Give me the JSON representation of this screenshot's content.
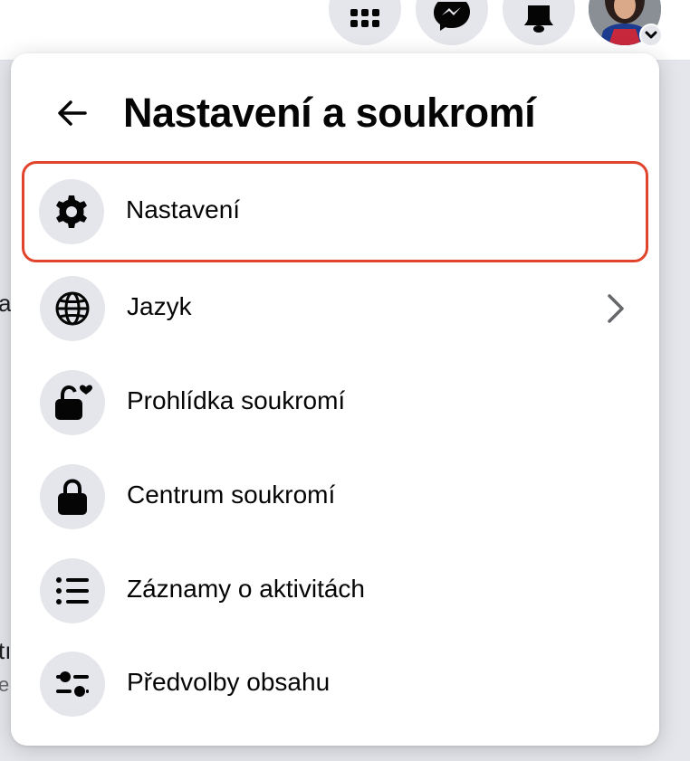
{
  "colors": {
    "page_bg": "#e4e6eb",
    "panel_bg": "#ffffff",
    "icon_bg": "#e4e6eb",
    "highlight_border": "#e0442c",
    "text": "#050505"
  },
  "topbar": {
    "icons": [
      "apps-grid-icon",
      "messenger-icon",
      "notifications-bell-icon",
      "profile-avatar",
      "chevron-down-icon"
    ]
  },
  "background_fragments": {
    "frag_1": "a",
    "frag_2": "tı",
    "frag_3": "e"
  },
  "panel": {
    "title": "Nastavení a soukromí",
    "back_icon": "arrow-left-icon",
    "items": [
      {
        "label": "Nastavení",
        "icon": "gear-icon",
        "highlighted": true,
        "has_chevron": false
      },
      {
        "label": "Jazyk",
        "icon": "globe-icon",
        "highlighted": false,
        "has_chevron": true
      },
      {
        "label": "Prohlídka soukromí",
        "icon": "lock-heart-icon",
        "highlighted": false,
        "has_chevron": false
      },
      {
        "label": "Centrum soukromí",
        "icon": "lock-icon",
        "highlighted": false,
        "has_chevron": false
      },
      {
        "label": "Záznamy o aktivitách",
        "icon": "list-icon",
        "highlighted": false,
        "has_chevron": false
      },
      {
        "label": "Předvolby obsahu",
        "icon": "sliders-icon",
        "highlighted": false,
        "has_chevron": false
      }
    ]
  }
}
